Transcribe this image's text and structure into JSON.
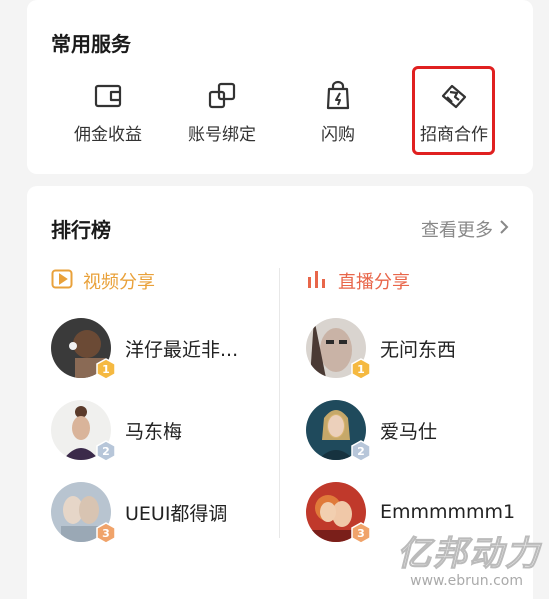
{
  "services": {
    "title": "常用服务",
    "items": [
      {
        "label": "佣金收益",
        "icon": "wallet-icon"
      },
      {
        "label": "账号绑定",
        "icon": "link-icon"
      },
      {
        "label": "闪购",
        "icon": "flash-bag-icon"
      },
      {
        "label": "招商合作",
        "icon": "handshake-icon"
      }
    ]
  },
  "ranking": {
    "title": "排行榜",
    "more": "查看更多",
    "video": {
      "title": "视频分享",
      "items": [
        {
          "name": "洋仔最近非...",
          "rank": "1"
        },
        {
          "name": "马东梅",
          "rank": "2"
        },
        {
          "name": "UEUI都得调",
          "rank": "3"
        }
      ]
    },
    "live": {
      "title": "直播分享",
      "items": [
        {
          "name": "无问东西",
          "rank": "1"
        },
        {
          "name": "爱马仕",
          "rank": "2"
        },
        {
          "name": "Emmmmmm1",
          "rank": "3"
        }
      ]
    }
  },
  "watermark": {
    "main": "亿邦动力",
    "sub": "www.ebrun.com"
  },
  "colors": {
    "highlight": "#e02020",
    "video_accent": "#e9a13a",
    "live_accent": "#e8664a",
    "rank1": "#f5b941",
    "rank2": "#b7c6d9",
    "rank3": "#f0a36a"
  }
}
